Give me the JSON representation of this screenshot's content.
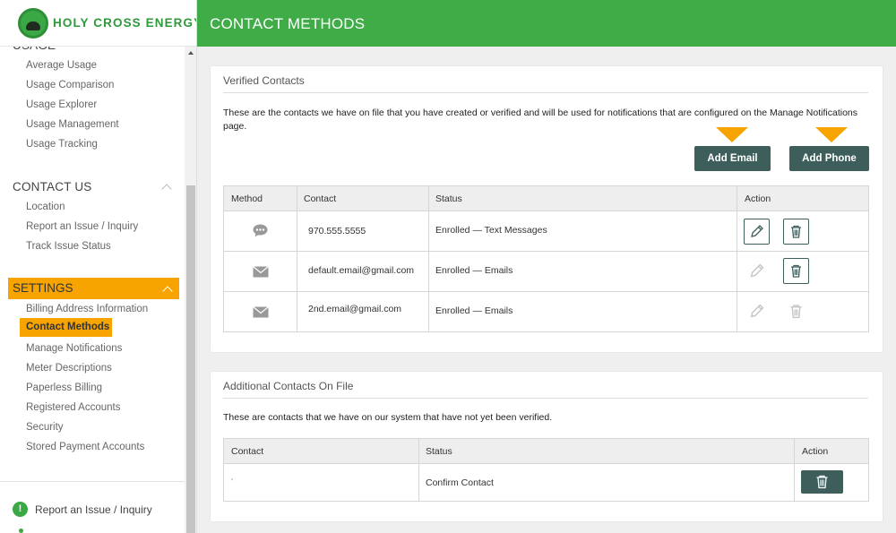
{
  "brand": {
    "name": "HOLY CROSS ENERGY",
    "primary_color": "#3fac48",
    "accent_color": "#f7a400",
    "button_color": "#3e5e5c"
  },
  "sidebar": {
    "usage_header_partial": "USAGE",
    "usage_items": [
      "Average Usage",
      "Usage Comparison",
      "Usage Explorer",
      "Usage Management",
      "Usage Tracking"
    ],
    "contact_us": {
      "label": "CONTACT US",
      "items": [
        "Location",
        "Report an Issue / Inquiry",
        "Track Issue Status"
      ]
    },
    "settings": {
      "label": "SETTINGS",
      "items": [
        "Billing Address Information",
        "Contact Methods",
        "Manage Notifications",
        "Meter Descriptions",
        "Paperless Billing",
        "Registered Accounts",
        "Security",
        "Stored Payment Accounts"
      ],
      "active": "Contact Methods"
    },
    "footer_link": "Report an Issue / Inquiry"
  },
  "header": {
    "title": "CONTACT METHODS"
  },
  "verified": {
    "title": "Verified Contacts",
    "description": "These are the contacts we have on file that you have created or verified and will be used for notifications that are configured on the Manage Notifications page.",
    "add_email_label": "Add Email",
    "add_phone_label": "Add Phone",
    "columns": [
      "Method",
      "Contact",
      "Status",
      "Action"
    ],
    "rows": [
      {
        "method_icon": "chat-bubble-icon",
        "contact": "970.555.5555",
        "status": "Enrolled — Text Messages",
        "edit_enabled": true,
        "delete_enabled": true
      },
      {
        "method_icon": "envelope-icon",
        "contact": "default.email@gmail.com",
        "status": "Enrolled — Emails",
        "edit_enabled": false,
        "delete_enabled": true
      },
      {
        "method_icon": "envelope-icon",
        "contact": "2nd.email@gmail.com",
        "status": "Enrolled — Emails",
        "edit_enabled": false,
        "delete_enabled": false
      }
    ]
  },
  "additional": {
    "title": "Additional Contacts On File",
    "description": "These are contacts that we have on our system that have not yet been verified.",
    "columns": [
      "Contact",
      "Status",
      "Action"
    ],
    "rows": [
      {
        "contact": "'",
        "status": "Confirm Contact"
      }
    ]
  }
}
